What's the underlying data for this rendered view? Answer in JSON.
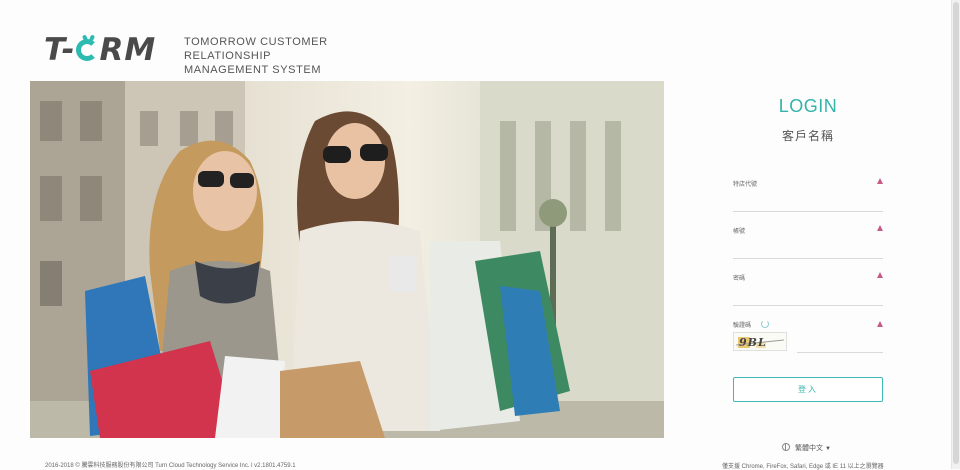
{
  "brand": {
    "logo_prefix": "T-",
    "logo_suffix": "RM",
    "tagline_line1": "TOMORROW  CUSTOMER  RELATIONSHIP",
    "tagline_line2": "MANAGEMENT  SYSTEM"
  },
  "login": {
    "title": "LOGIN",
    "customer_name": "客戶名稱",
    "fields": [
      {
        "label": "特店代號",
        "value": ""
      },
      {
        "label": "帳號",
        "value": ""
      },
      {
        "label": "密碼",
        "value": ""
      }
    ],
    "captcha_label": "驗證碼",
    "captcha_text": "9BL",
    "captcha_value": "",
    "submit_label": "登入"
  },
  "footer": {
    "language": "繁體中文",
    "browser_note": "僅支援 Chrome, FireFox, Safari, Edge 或 IE 11 以上之瀏覽器",
    "copyright": "2016-2018 © 騰雲科技服務股份有限公司 Turn Cloud Technology Service Inc.    l    v2.1801.4759.1"
  },
  "colors": {
    "accent": "#34b3ab",
    "required_marker": "#c85a8a"
  }
}
